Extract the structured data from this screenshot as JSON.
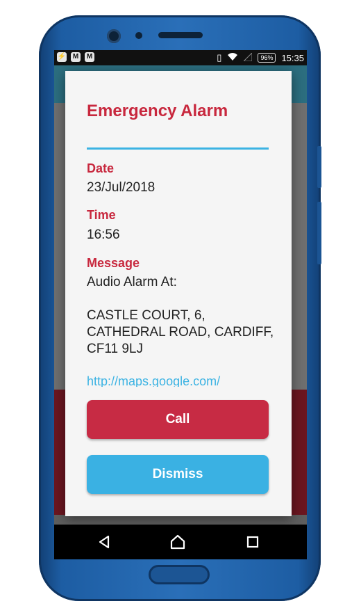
{
  "status_bar": {
    "battery": "96%",
    "time": "15:35"
  },
  "dialog": {
    "title": "Emergency Alarm",
    "date_label": "Date",
    "date_value": "23/Jul/2018",
    "time_label": "Time",
    "time_value": "16:56",
    "message_label": "Message",
    "message_text": "Audio Alarm At:\n\nCASTLE COURT, 6,\nCATHEDRAL ROAD, CARDIFF,\nCF11 9LJ",
    "message_link": "http://maps.google.com/",
    "call_button": "Call",
    "dismiss_button": "Dismiss"
  },
  "colors": {
    "accent_red": "#c8283e",
    "accent_blue": "#3cb3e3",
    "phone_blue": "#2a6fb8"
  },
  "icons": {
    "nav": [
      "back-icon",
      "home-icon",
      "recent-apps-icon"
    ]
  }
}
